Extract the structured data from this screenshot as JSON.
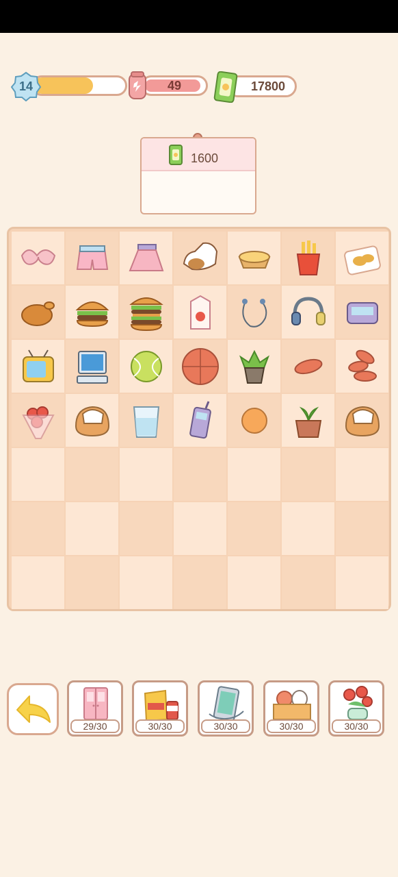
{
  "hud": {
    "level": "14",
    "level_progress": 0.65,
    "energy": "49",
    "cash": "17800"
  },
  "order": {
    "reward": "1600"
  },
  "board": {
    "columns": 7,
    "rows": 7,
    "items": [
      "bra",
      "pink-shorts",
      "pink-skirt",
      "sneaker",
      "egg-tart",
      "french-fries",
      "chicken-nuggets",
      "roast-chicken",
      "burger",
      "double-burger",
      "strawberry-milk",
      "earphones",
      "headphones",
      "pager",
      "television",
      "computer",
      "tennis-ball",
      "basketball",
      "succulent",
      "sweet-potato",
      "sweet-potatoes",
      "rose-bouquet",
      "slipper",
      "glass-of-water",
      "retro-phone",
      "orange",
      "seedling",
      "slipper",
      "",
      "",
      "",
      "",
      "",
      "",
      "",
      "",
      "",
      "",
      "",
      "",
      "",
      "",
      "",
      "",
      "",
      "",
      "",
      "",
      ""
    ]
  },
  "tray": {
    "back_icon": "back-arrow-icon",
    "categories": [
      {
        "name": "wardrobe",
        "count": "29/30"
      },
      {
        "name": "snacks",
        "count": "30/30"
      },
      {
        "name": "electronics",
        "count": "30/30"
      },
      {
        "name": "toy-box",
        "count": "30/30"
      },
      {
        "name": "flowers",
        "count": "30/30"
      }
    ]
  },
  "colors": {
    "background": "#fbf1e4",
    "board": "#f6d3b6",
    "cell_light": "#fde7d4",
    "level_fill": "#f7c35a",
    "energy_fill": "#f29a98"
  }
}
